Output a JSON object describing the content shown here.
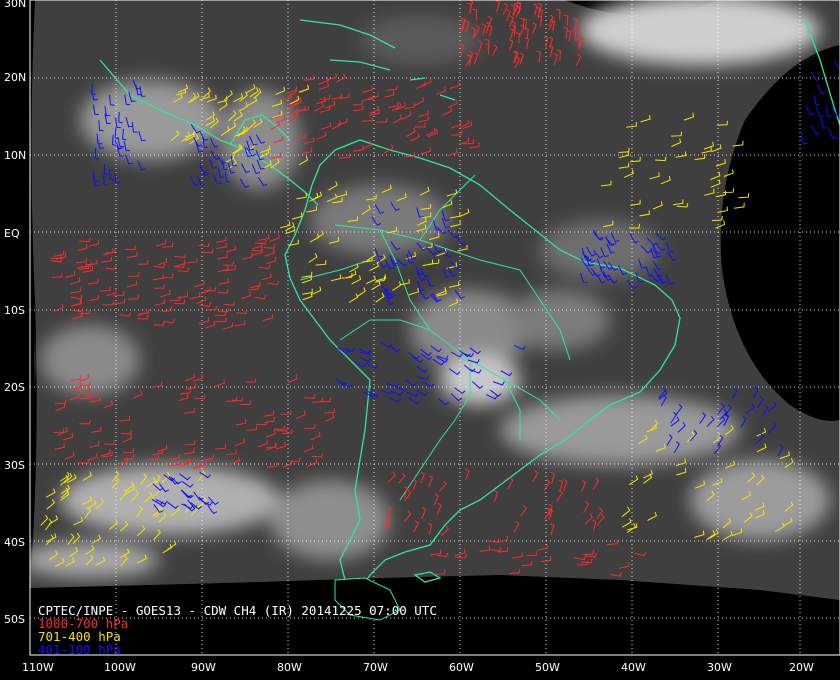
{
  "title": "CPTEC/INPE - GOES13 - CDW CH4 (IR) 20141225 07:00 UTC",
  "legend": [
    {
      "label": "1000-700 hPa",
      "color": "#ff2a2a"
    },
    {
      "label": "701-400 hPa",
      "color": "#f4e600"
    },
    {
      "label": "401-100 hPa",
      "color": "#1010ff"
    }
  ],
  "lat_labels": [
    "30N",
    "20N",
    "10N",
    "EQ",
    "10S",
    "20S",
    "30S",
    "40S",
    "50S"
  ],
  "lon_labels": [
    "110W",
    "100W",
    "90W",
    "80W",
    "70W",
    "60W",
    "50W",
    "40W",
    "30W",
    "20W"
  ],
  "colors": {
    "coastline": "#2ee6a0",
    "grid": "#ffffff",
    "background": "#000000"
  }
}
